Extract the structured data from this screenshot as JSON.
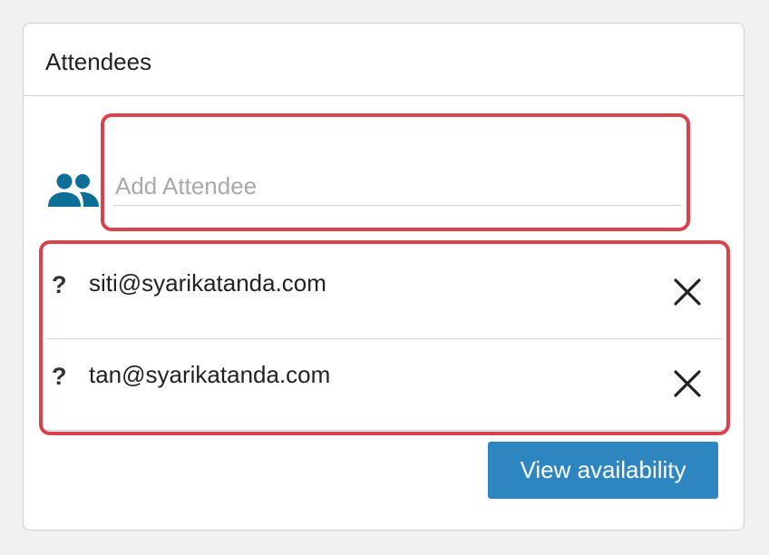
{
  "panel": {
    "title": "Attendees"
  },
  "add_attendee": {
    "placeholder": "Add Attendee",
    "icon": "people-icon"
  },
  "attendees": [
    {
      "status": "?",
      "email": "siti@syarikatanda.com",
      "remove_icon": "close-icon"
    },
    {
      "status": "?",
      "email": "tan@syarikatanda.com",
      "remove_icon": "close-icon"
    }
  ],
  "actions": {
    "view_availability_label": "View availability"
  },
  "colors": {
    "accent": "#2e86c1",
    "icon": "#0d6e96",
    "highlight": "#d9434e"
  }
}
